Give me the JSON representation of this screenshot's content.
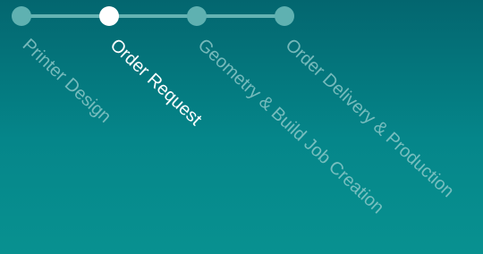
{
  "stepper": {
    "steps": [
      {
        "label": "Printer Design",
        "state": "completed"
      },
      {
        "label": "Order Request",
        "state": "active"
      },
      {
        "label": "Geometry & Build Job Creation",
        "state": "upcoming"
      },
      {
        "label": "Order Delivery & Production",
        "state": "upcoming"
      }
    ],
    "active_step": 2,
    "total_steps": 4
  },
  "colors": {
    "background_top": "#03666f",
    "background_bottom": "#089190",
    "track": "#64b3b3",
    "dot_inactive": "#5fb1b1",
    "dot_active": "#ffffff",
    "label_inactive": "#96cdcd",
    "label_active": "#ffffff"
  }
}
